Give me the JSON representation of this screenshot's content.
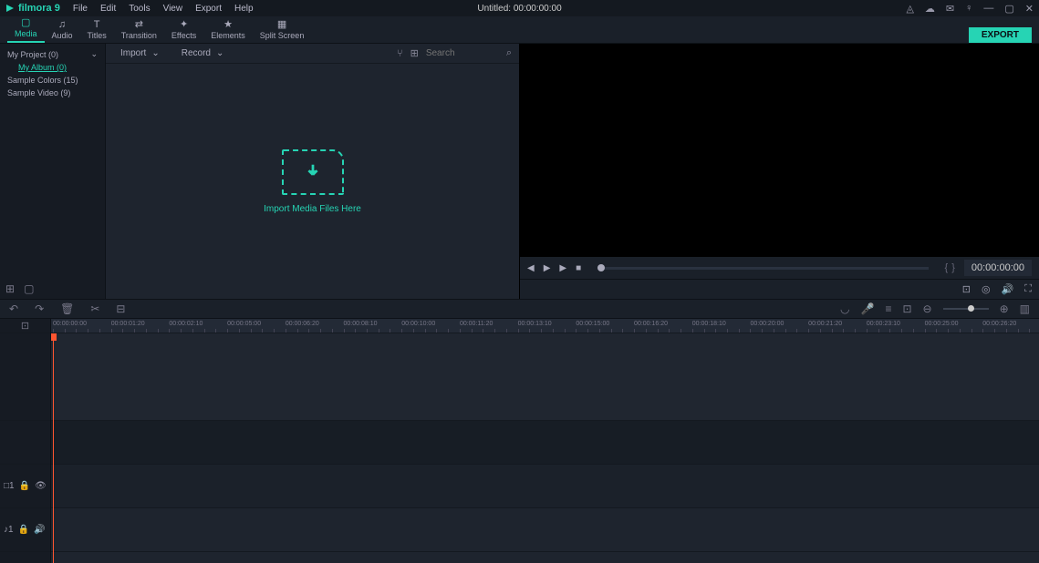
{
  "app": {
    "name": "filmora 9",
    "title": "Untitled:  00:00:00:00"
  },
  "menu": [
    "File",
    "Edit",
    "Tools",
    "View",
    "Export",
    "Help"
  ],
  "tabs": [
    {
      "label": "Media",
      "icon": "folder"
    },
    {
      "label": "Audio",
      "icon": "music"
    },
    {
      "label": "Titles",
      "icon": "T"
    },
    {
      "label": "Transition",
      "icon": "transition"
    },
    {
      "label": "Effects",
      "icon": "fx"
    },
    {
      "label": "Elements",
      "icon": "star"
    },
    {
      "label": "Split Screen",
      "icon": "grid"
    }
  ],
  "active_tab": 0,
  "export_label": "EXPORT",
  "sidebar": {
    "items": [
      {
        "label": "My Project (0)",
        "expandable": true
      },
      {
        "label": "My Album (0)",
        "sub": true
      },
      {
        "label": "Sample Colors (15)"
      },
      {
        "label": "Sample Video (9)"
      }
    ]
  },
  "media_toolbar": {
    "import": "Import",
    "record": "Record",
    "search_placeholder": "Search"
  },
  "dropzone_text": "Import Media Files Here",
  "preview": {
    "time": "00:00:00:00"
  },
  "timeline": {
    "marks": [
      "00:00:00:00",
      "00:00:01:20",
      "00:00:02:10",
      "00:00:05:00",
      "00:00:06:20",
      "00:00:08:10",
      "00:00:10:00",
      "00:00:11:20",
      "00:00:13:10",
      "00:00:15:00",
      "00:00:16:20",
      "00:00:18:10",
      "00:00:20:00",
      "00:00:21:20",
      "00:00:23:10",
      "00:00:25:00",
      "00:00:26:20"
    ],
    "tracks": [
      {
        "name": "□1",
        "icons": [
          "lock",
          "eye"
        ]
      },
      {
        "name": "♪1",
        "icons": [
          "lock",
          "vol"
        ]
      }
    ]
  }
}
